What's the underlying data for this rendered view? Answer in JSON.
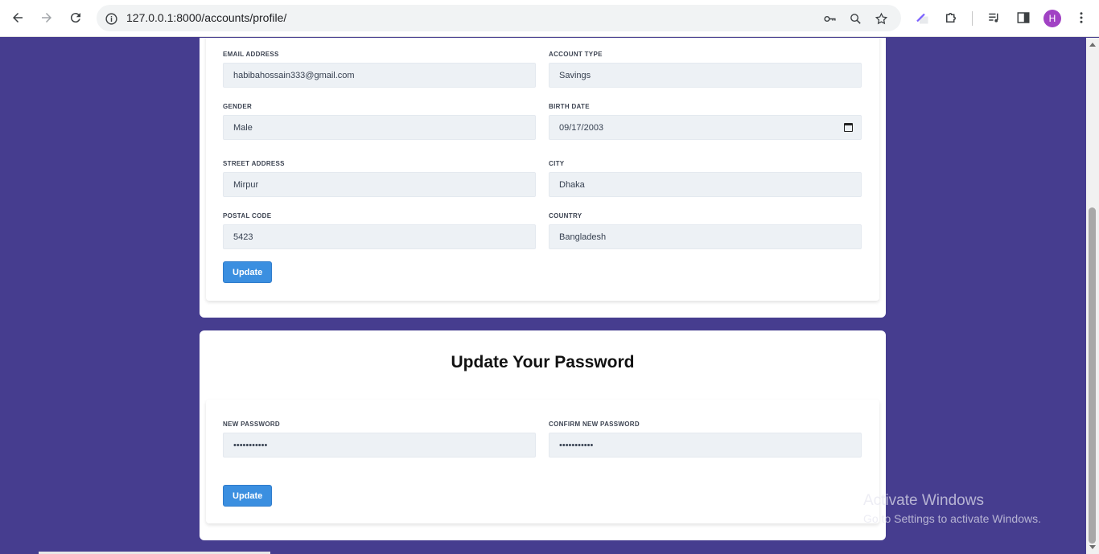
{
  "browser": {
    "url": "127.0.0.1:8000/accounts/profile/",
    "avatar_letter": "H",
    "avatar_color": "#a142c4"
  },
  "profile_form": {
    "email_label": "EMAIL ADDRESS",
    "email_value": "habibahossain333@gmail.com",
    "account_type_label": "ACCOUNT TYPE",
    "account_type_value": "Savings",
    "gender_label": "GENDER",
    "gender_value": "Male",
    "birth_date_label": "BIRTH DATE",
    "birth_date_value": "09/17/2003",
    "street_label": "STREET ADDRESS",
    "street_value": "Mirpur",
    "city_label": "CITY",
    "city_value": "Dhaka",
    "postal_label": "POSTAL CODE",
    "postal_value": "5423",
    "country_label": "COUNTRY",
    "country_value": "Bangladesh",
    "update_label": "Update"
  },
  "password_form": {
    "title": "Update Your Password",
    "new_password_label": "NEW PASSWORD",
    "new_password_value": "•••••••••••",
    "confirm_password_label": "CONFIRM NEW PASSWORD",
    "confirm_password_value": "•••••••••••",
    "update_label": "Update"
  },
  "watermark": {
    "title": "Activate Windows",
    "subtitle": "Go to Settings to activate Windows."
  },
  "colors": {
    "page_background": "#463d8f",
    "button": "#3b8fe0",
    "field_background": "#edf1f5"
  }
}
